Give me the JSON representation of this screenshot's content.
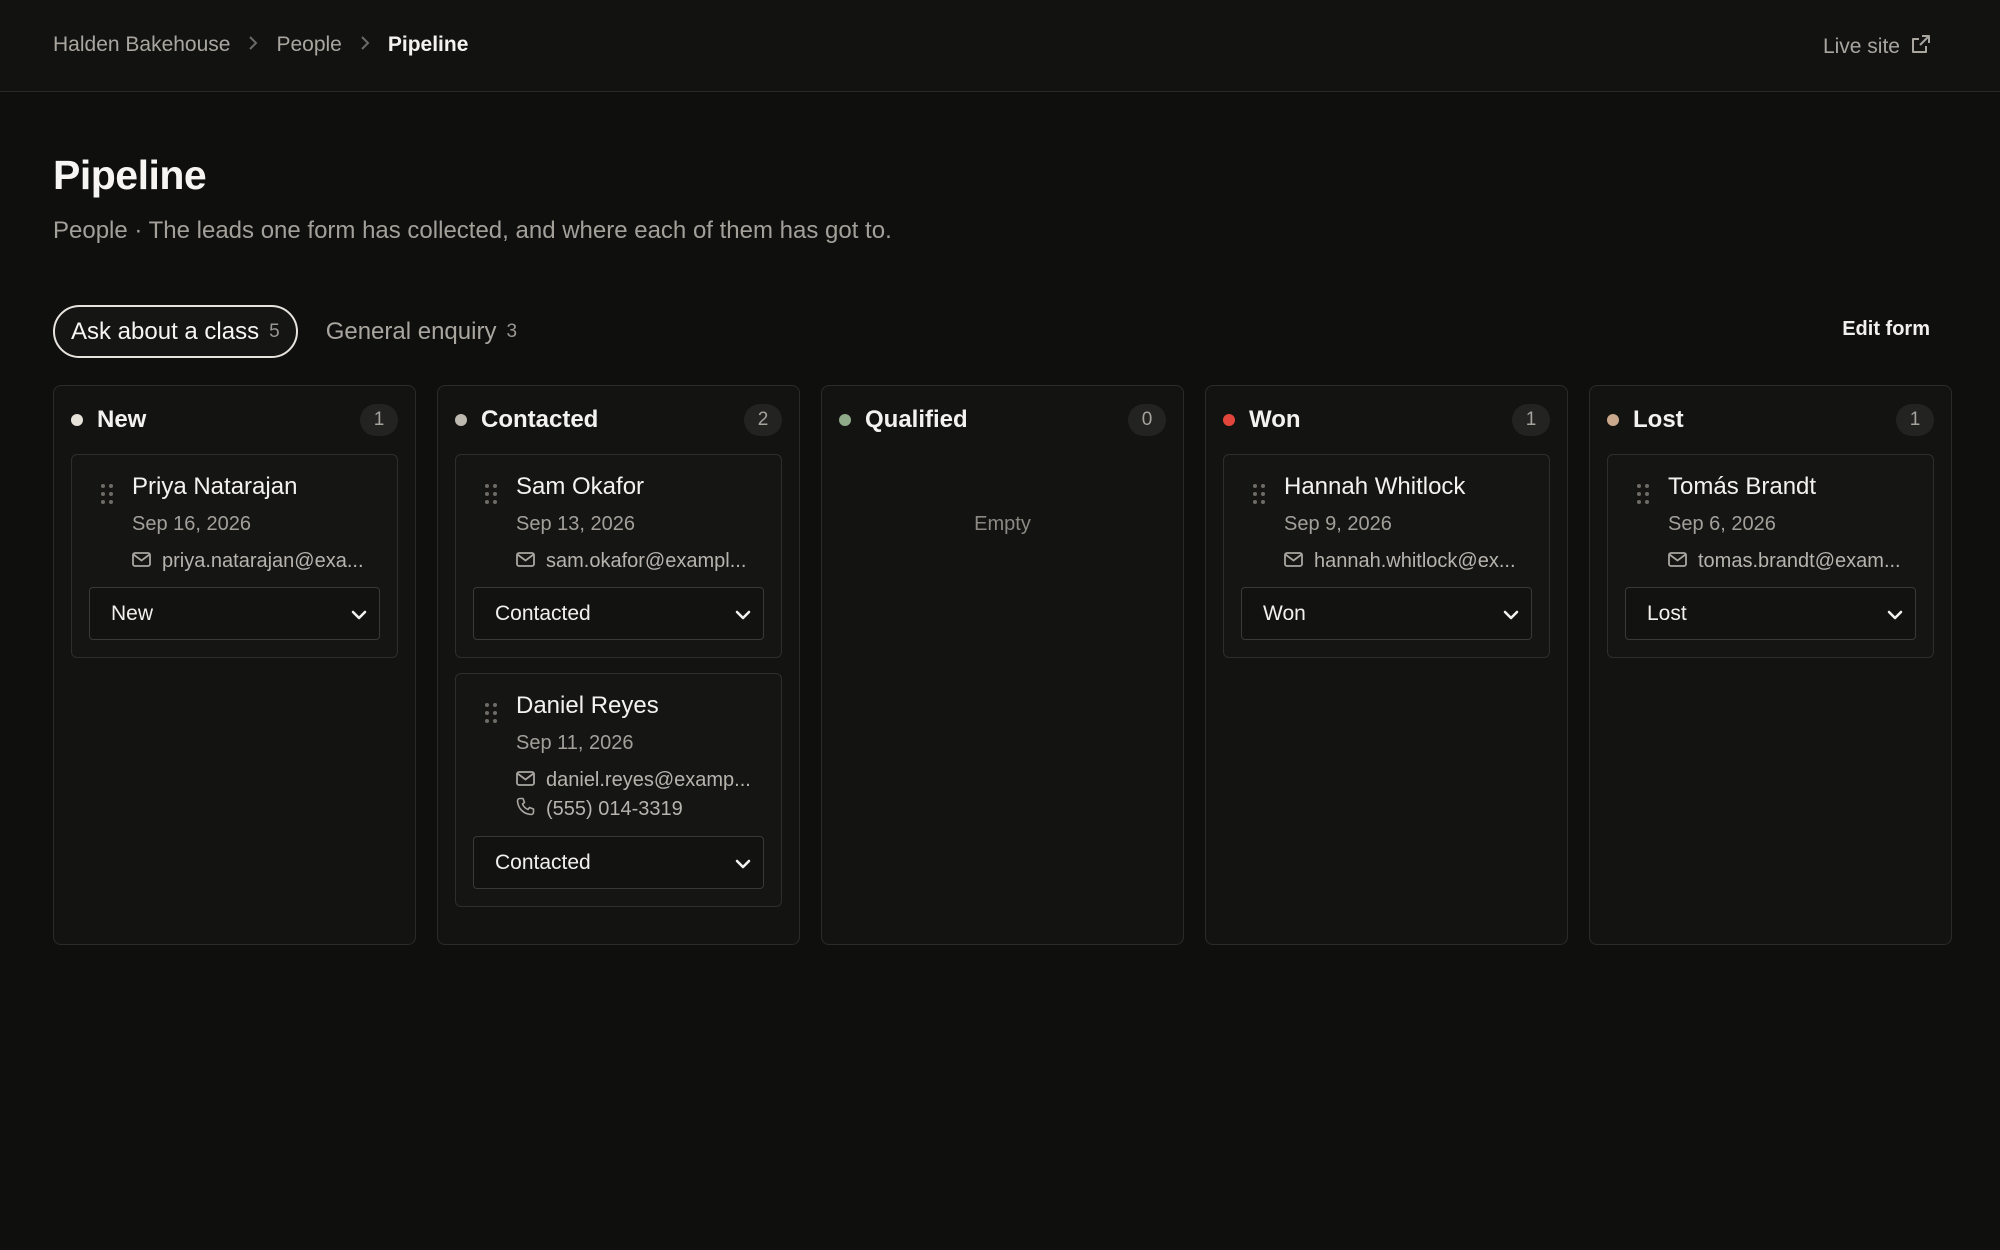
{
  "breadcrumb": [
    "Halden Bakehouse",
    "People",
    "Pipeline"
  ],
  "live_site_label": "Live site",
  "page": {
    "title": "Pipeline",
    "subtitle": "People · The leads one form has collected, and where each of them has got to."
  },
  "tabs": [
    {
      "label": "Ask about a class",
      "count": "5",
      "active": true
    },
    {
      "label": "General enquiry",
      "count": "3",
      "active": false
    }
  ],
  "edit_form_label": "Edit form",
  "columns": [
    {
      "name": "New",
      "count": "1",
      "color": "#e6e2da",
      "cards": [
        {
          "name": "Priya Natarajan",
          "date": "Sep 16, 2026",
          "email": "priya.natarajan@exa...",
          "status": "New"
        }
      ]
    },
    {
      "name": "Contacted",
      "count": "2",
      "color": "#bdb9b1",
      "cards": [
        {
          "name": "Sam Okafor",
          "date": "Sep 13, 2026",
          "email": "sam.okafor@exampl...",
          "status": "Contacted"
        },
        {
          "name": "Daniel Reyes",
          "date": "Sep 11, 2026",
          "email": "daniel.reyes@examp...",
          "phone": "(555) 014-3319",
          "status": "Contacted"
        }
      ]
    },
    {
      "name": "Qualified",
      "count": "0",
      "color": "#8faa88",
      "empty_label": "Empty",
      "cards": []
    },
    {
      "name": "Won",
      "count": "1",
      "color": "#e2463b",
      "cards": [
        {
          "name": "Hannah Whitlock",
          "date": "Sep 9, 2026",
          "email": "hannah.whitlock@ex...",
          "status": "Won"
        }
      ]
    },
    {
      "name": "Lost",
      "count": "1",
      "color": "#c9a88b",
      "cards": [
        {
          "name": "Tomás Brandt",
          "date": "Sep 6, 2026",
          "email": "tomas.brandt@exam...",
          "status": "Lost"
        }
      ]
    }
  ],
  "icons": {
    "breadcrumb_separator": "chevron-right-icon",
    "live_site": "external-link-icon",
    "grip": "drag-handle-icon",
    "email": "mail-icon",
    "phone": "phone-icon",
    "select": "chevron-down-icon"
  }
}
